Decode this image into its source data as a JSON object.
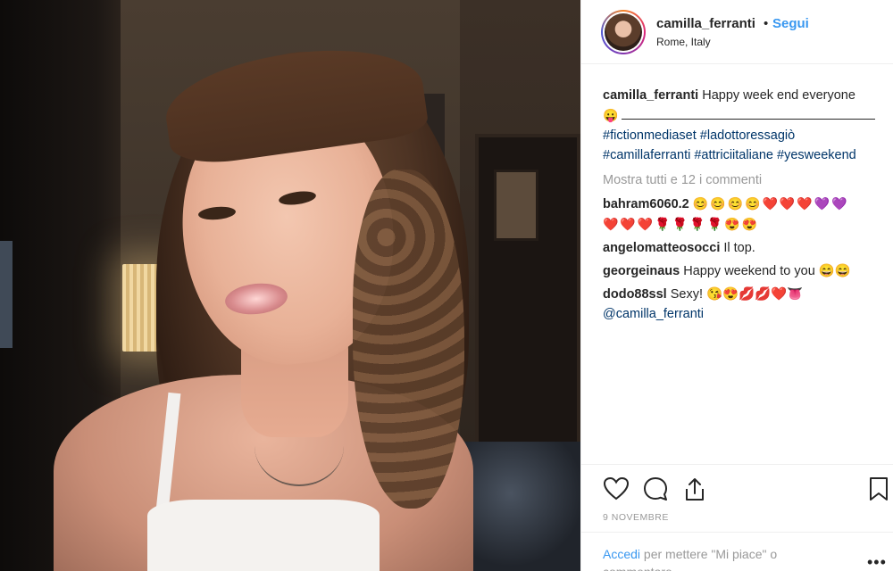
{
  "post": {
    "username": "camilla_ferranti",
    "separator": "•",
    "follow_label": "Segui",
    "location": "Rome, Italy"
  },
  "caption": {
    "username": "camilla_ferranti",
    "text": "Happy week end everyone",
    "emoji": "😛",
    "hashtags_line1": "#fictionmediaset #ladottoressagiò",
    "hashtags_line2": "#camillaferranti #attriciitaliane #yesweekend"
  },
  "show_all_comments": "Mostra tutti e 12 i commenti",
  "comments": [
    {
      "username": "bahram6060.2",
      "text": "😊😊😊😊❤️❤️❤️💜💜",
      "text2": "❤️❤️❤️🌹🌹🌹🌹😍😍"
    },
    {
      "username": "angelomatteosocci",
      "text": "Il top."
    },
    {
      "username": "georgeinaus",
      "text": "Happy weekend to you 😄😄"
    },
    {
      "username": "dodo88ssl",
      "text": "Sexy! 😘😍💋💋❤️👅",
      "mention": "@camilla_ferranti"
    }
  ],
  "date": "9 NOVEMBRE",
  "login_prompt": {
    "link": "Accedi",
    "text": "per mettere \"Mi piace\" o",
    "text2": "commentare"
  },
  "icons": {
    "like": "heart-icon",
    "comment": "comment-icon",
    "share": "share-icon",
    "save": "bookmark-icon",
    "more": "more-options-icon"
  },
  "colors": {
    "link_blue": "#3897f0",
    "hashtag": "#003569",
    "muted": "#999999"
  }
}
